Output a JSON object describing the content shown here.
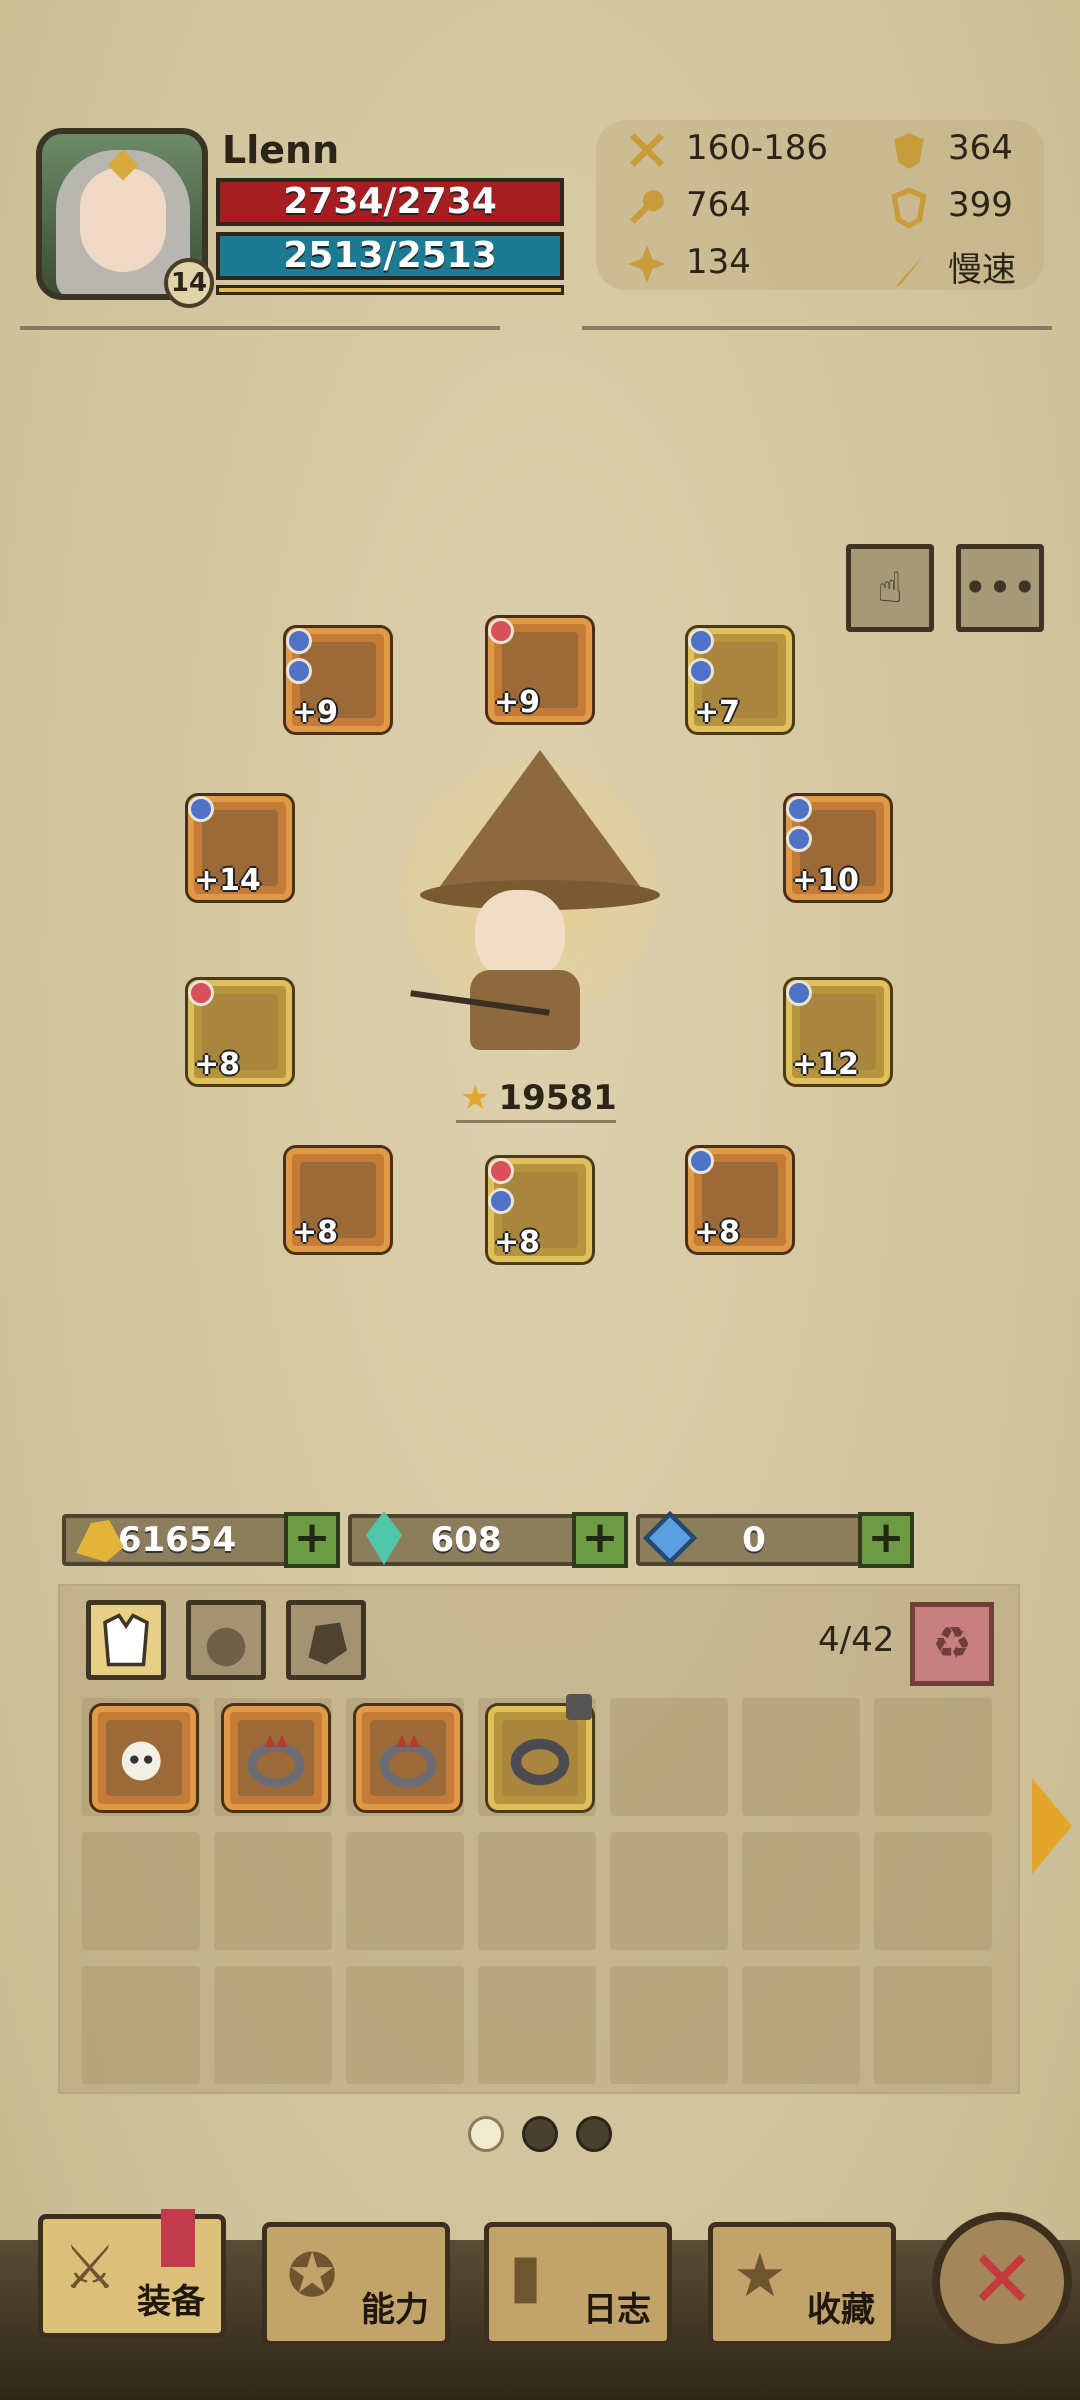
{
  "player": {
    "name": "Llenn",
    "level": "14",
    "hp": "2734/2734",
    "mp": "2513/2513"
  },
  "stats": {
    "attack": "160-186",
    "defense": "364",
    "magic": "764",
    "magic_defense": "399",
    "crit": "134",
    "attack_speed": "慢速"
  },
  "power": "19581",
  "equipment": [
    {
      "plus": "+9"
    },
    {
      "plus": "+9"
    },
    {
      "plus": "+7"
    },
    {
      "plus": "+14"
    },
    {
      "plus": "+10"
    },
    {
      "plus": "+8"
    },
    {
      "plus": "+12"
    },
    {
      "plus": "+8"
    },
    {
      "plus": "+8"
    },
    {
      "plus": "+8"
    }
  ],
  "currency": {
    "gold": "61654",
    "crystal": "608",
    "gem": "0"
  },
  "inventory": {
    "count": "4/42"
  },
  "nav": {
    "equip": "装备",
    "ability": "能力",
    "journal": "日志",
    "collection": "收藏"
  },
  "colors": {
    "hp": "#a71e22",
    "mp": "#1d7a93",
    "accent": "#e3a52a"
  }
}
